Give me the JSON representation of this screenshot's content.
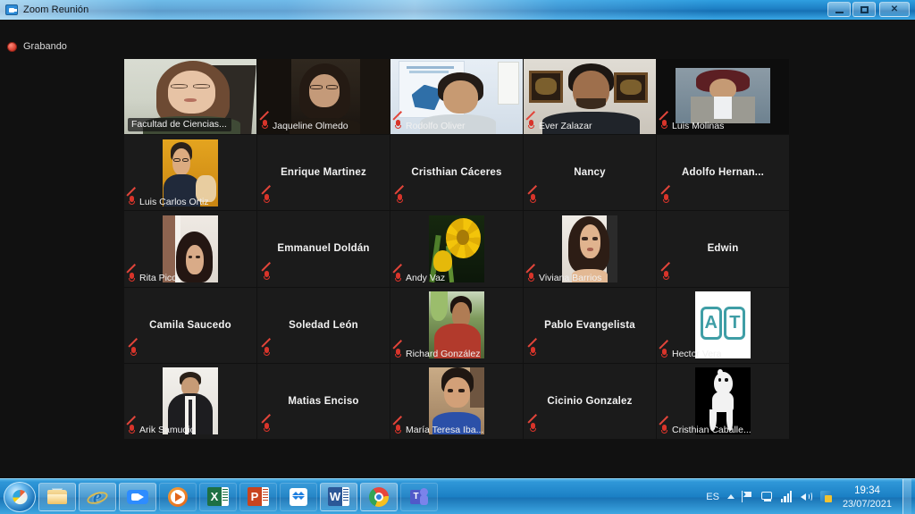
{
  "window": {
    "title": "Zoom Reunión",
    "icon": "zoom-icon",
    "minimize_label": "Minimizar",
    "maximize_label": "Maximizar",
    "close_label": "Cerrar"
  },
  "app": {
    "recording_label": "Grabando"
  },
  "participants": [
    {
      "name": "Facultad de Ciencias...",
      "video": true,
      "active_speaker": true,
      "muted": false,
      "name_boxed": true,
      "kind": "video-woman-glasses"
    },
    {
      "name": "Jaqueline Olmedo",
      "video": true,
      "active_speaker": false,
      "muted": true,
      "name_boxed": false,
      "kind": "video-woman-dark"
    },
    {
      "name": "Rodolfo Oliver",
      "video": true,
      "active_speaker": false,
      "muted": true,
      "name_boxed": false,
      "kind": "video-man-banner"
    },
    {
      "name": "Ever Zalazar",
      "video": true,
      "active_speaker": false,
      "muted": true,
      "name_boxed": false,
      "kind": "video-man-frames"
    },
    {
      "name": "Luis Molinas",
      "video": true,
      "active_speaker": false,
      "muted": true,
      "name_boxed": false,
      "kind": "video-man-suit"
    },
    {
      "name": "Luis Carlos Ortiz",
      "video": false,
      "active_speaker": false,
      "muted": true,
      "name_boxed": false,
      "kind": "photo-orange-man"
    },
    {
      "name": "Enrique Martinez",
      "video": false,
      "active_speaker": false,
      "muted": true,
      "name_boxed": false,
      "kind": "name-only"
    },
    {
      "name": "Cristhian Cáceres",
      "video": false,
      "active_speaker": false,
      "muted": true,
      "name_boxed": false,
      "kind": "name-only"
    },
    {
      "name": "Nancy",
      "video": false,
      "active_speaker": false,
      "muted": true,
      "name_boxed": false,
      "kind": "name-only"
    },
    {
      "name": "Adolfo  Hernan...",
      "video": false,
      "active_speaker": false,
      "muted": true,
      "name_boxed": false,
      "kind": "name-only"
    },
    {
      "name": "Rita Pico",
      "video": false,
      "active_speaker": false,
      "muted": true,
      "name_boxed": false,
      "kind": "photo-woman-wall"
    },
    {
      "name": "Emmanuel Doldán",
      "video": false,
      "active_speaker": false,
      "muted": true,
      "name_boxed": false,
      "kind": "name-only"
    },
    {
      "name": "Andy Vaz",
      "video": false,
      "active_speaker": false,
      "muted": true,
      "name_boxed": false,
      "kind": "photo-flower"
    },
    {
      "name": "Viviana Barrios",
      "video": false,
      "active_speaker": false,
      "muted": true,
      "name_boxed": false,
      "kind": "photo-woman-portrait"
    },
    {
      "name": "Edwin",
      "video": false,
      "active_speaker": false,
      "muted": true,
      "name_boxed": false,
      "kind": "name-only"
    },
    {
      "name": "Camila Saucedo",
      "video": false,
      "active_speaker": false,
      "muted": true,
      "name_boxed": false,
      "kind": "name-only"
    },
    {
      "name": "Soledad León",
      "video": false,
      "active_speaker": false,
      "muted": true,
      "name_boxed": false,
      "kind": "name-only"
    },
    {
      "name": "Richard González",
      "video": false,
      "active_speaker": false,
      "muted": true,
      "name_boxed": false,
      "kind": "photo-man-red-shirt"
    },
    {
      "name": "Pablo Evangelista",
      "video": false,
      "active_speaker": false,
      "muted": true,
      "name_boxed": false,
      "kind": "name-only"
    },
    {
      "name": "Hector Vera",
      "video": false,
      "active_speaker": false,
      "muted": true,
      "name_boxed": false,
      "kind": "photo-at-logo",
      "logo_text": "AT"
    },
    {
      "name": "Arik Samudio",
      "video": false,
      "active_speaker": false,
      "muted": true,
      "name_boxed": false,
      "kind": "photo-man-suit"
    },
    {
      "name": "Matias Enciso",
      "video": false,
      "active_speaker": false,
      "muted": true,
      "name_boxed": false,
      "kind": "name-only"
    },
    {
      "name": "María Teresa Iba...",
      "video": false,
      "active_speaker": false,
      "muted": true,
      "name_boxed": false,
      "kind": "photo-teen-blue"
    },
    {
      "name": "Cicinio Gonzalez",
      "video": false,
      "active_speaker": false,
      "muted": true,
      "name_boxed": false,
      "kind": "name-only"
    },
    {
      "name": "Cristhian Caballe...",
      "video": false,
      "active_speaker": false,
      "muted": true,
      "name_boxed": false,
      "kind": "photo-cartoon-bw"
    }
  ],
  "taskbar": {
    "start_label": "Inicio",
    "items": [
      {
        "label": "Explorador de archivos",
        "icon": "folder-icon"
      },
      {
        "label": "Internet Explorer",
        "icon": "internet-explorer-icon"
      },
      {
        "label": "Zoom",
        "icon": "zoom-camera-icon"
      },
      {
        "label": "Reproductor multimedia",
        "icon": "media-player-icon"
      },
      {
        "label": "Excel",
        "icon": "excel-icon",
        "letter": "X"
      },
      {
        "label": "PowerPoint",
        "icon": "powerpoint-icon",
        "letter": "P"
      },
      {
        "label": "Dropbox",
        "icon": "dropbox-icon"
      },
      {
        "label": "Word",
        "icon": "word-icon",
        "letter": "W"
      },
      {
        "label": "Google Chrome",
        "icon": "chrome-icon"
      },
      {
        "label": "Microsoft Teams",
        "icon": "teams-icon",
        "letter": "T"
      }
    ],
    "tray": {
      "language": "ES",
      "icons": [
        "show-hidden-icons-caret",
        "flag-action-center-icon",
        "network-icon",
        "signal-icon",
        "volume-icon",
        "security-shield-icon"
      ],
      "time": "19:34",
      "date": "23/07/2021"
    }
  },
  "colors": {
    "active_speaker_border": "#bde04a",
    "muted_mic": "#d8342a",
    "recording_dot": "#d33b2c",
    "app_background": "#111111",
    "tile_background": "#1b1b1b",
    "taskbar": "#1a7fc4"
  }
}
